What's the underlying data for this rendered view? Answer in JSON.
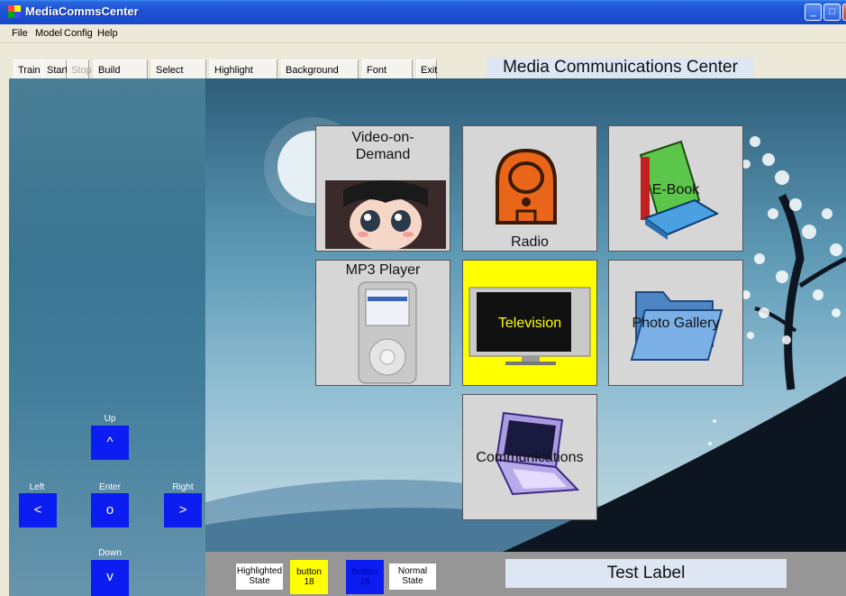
{
  "window": {
    "title": "MediaCommsCenter",
    "controls": {
      "minimize": "_",
      "maximize": "□",
      "close": "X"
    }
  },
  "menu": [
    "File",
    "Model",
    "Config",
    "Help"
  ],
  "toolbar": {
    "buttons": [
      {
        "label": "Train",
        "enabled": true
      },
      {
        "label": "Start",
        "enabled": true
      },
      {
        "label": "Stop",
        "enabled": false
      },
      {
        "label": "Build Model",
        "enabled": true
      },
      {
        "label": "Select Model",
        "enabled": true
      },
      {
        "label": "Highlight Colour",
        "enabled": true
      },
      {
        "label": "Background Colour",
        "enabled": true
      },
      {
        "label": "Font Colour",
        "enabled": true
      },
      {
        "label": "Exit",
        "enabled": true
      }
    ],
    "title": "Media Communications Center"
  },
  "nav_pad": {
    "up": {
      "label": "Up",
      "glyph": "^"
    },
    "left": {
      "label": "Left",
      "glyph": "<"
    },
    "enter": {
      "label": "Enter",
      "glyph": "o"
    },
    "right": {
      "label": "Right",
      "glyph": ">"
    },
    "down": {
      "label": "Down",
      "glyph": "v"
    }
  },
  "tiles": [
    {
      "label": "Video-on-Demand",
      "label_lines": [
        "Video-on-",
        "Demand"
      ],
      "icon": "anime-portrait-image",
      "highlighted": false
    },
    {
      "label": "Radio",
      "icon": "radio-icon",
      "highlighted": false
    },
    {
      "label": "E-Book",
      "icon": "book-icon",
      "highlighted": false
    },
    {
      "label": "MP3 Player",
      "icon": "ipod-icon",
      "highlighted": false
    },
    {
      "label": "Television",
      "icon": "television-icon",
      "highlighted": true
    },
    {
      "label": "Photo Gallery",
      "icon": "folder-icon",
      "highlighted": false
    },
    {
      "label": "Communications",
      "icon": "laptop-icon",
      "highlighted": false
    }
  ],
  "status": {
    "highlighted_state": "Highlighted State",
    "highlighted_state_lines": [
      "Highlighted",
      "State"
    ],
    "sample_highlight": {
      "line1": "button",
      "line2": "18"
    },
    "sample_normal": {
      "line1": "button",
      "line2": "18"
    },
    "normal_state_lines": [
      "Normal",
      "State"
    ],
    "test_label": "Test Label"
  },
  "colors": {
    "highlight": "#ffff00",
    "button_blue": "#0b1df0",
    "tile_normal": "#d6d6d6",
    "title_bar": "#1f52d6"
  }
}
